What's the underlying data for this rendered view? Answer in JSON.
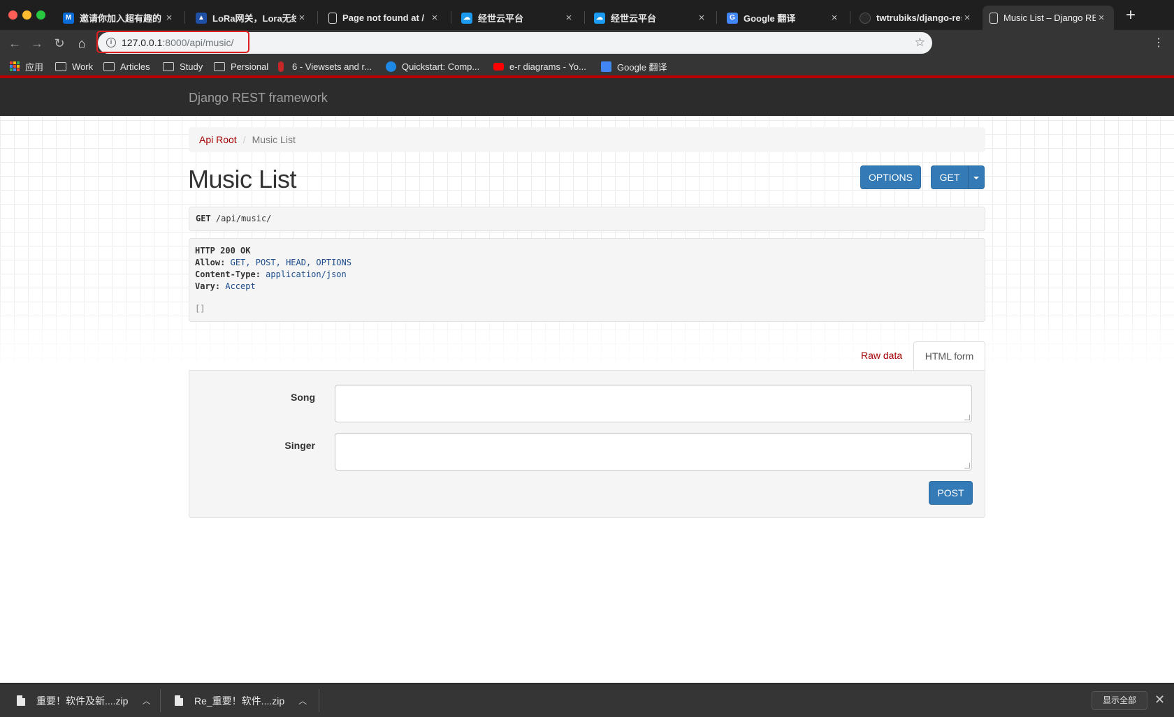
{
  "browser": {
    "tabs": [
      {
        "label": "邀请你加入超有趣的 CSDN",
        "icon": "mail-icon",
        "color": "#0a6cd6"
      },
      {
        "label": "LoRa网关，Lora无线数传",
        "icon": "lora-icon",
        "color": "#4285f4"
      },
      {
        "label": "Page not found at /",
        "icon": "page-icon",
        "color": "#cccccc"
      },
      {
        "label": "经世云平台",
        "icon": "cloud-icon",
        "color": "#1a9bf0"
      },
      {
        "label": "经世云平台",
        "icon": "cloud-icon",
        "color": "#1a9bf0"
      },
      {
        "label": "Google 翻译",
        "icon": "translate-icon",
        "color": "#4285f4"
      },
      {
        "label": "twtrubiks/django-rest-framework",
        "icon": "github-icon",
        "color": "#333333"
      },
      {
        "label": "Music List – Django REST framework",
        "icon": "page-icon",
        "color": "#cccccc",
        "active": true
      }
    ],
    "url_host": "127.0.0.1",
    "url_rest": ":8000/api/music/",
    "bookmarks": [
      {
        "label": "应用",
        "kind": "apps"
      },
      {
        "label": "Work",
        "kind": "folder"
      },
      {
        "label": "Articles",
        "kind": "folder"
      },
      {
        "label": "Study",
        "kind": "folder"
      },
      {
        "label": "Persional",
        "kind": "folder"
      },
      {
        "label": "6 - Viewsets and r...",
        "kind": "bookmark-icon",
        "color": "#c62828"
      },
      {
        "label": "Quickstart: Comp...",
        "kind": "edge-icon",
        "color": "#1e88e5"
      },
      {
        "label": "e-r diagrams - Yo...",
        "kind": "youtube-icon",
        "color": "#ff0000"
      },
      {
        "label": "Google 翻译",
        "kind": "translate-icon",
        "color": "#4285f4"
      }
    ]
  },
  "drf": {
    "brand": "Django REST framework",
    "breadcrumb": {
      "root": "Api Root",
      "sep": "/",
      "current": "Music List"
    },
    "title": "Music List",
    "options_label": "OPTIONS",
    "get_label": "GET",
    "request": {
      "method": "GET",
      "path": "/api/music/"
    },
    "response": {
      "status": "HTTP 200 OK",
      "allow_key": "Allow:",
      "allow_val": "GET, POST, HEAD, OPTIONS",
      "ctype_key": "Content-Type:",
      "ctype_val": "application/json",
      "vary_key": "Vary:",
      "vary_val": "Accept",
      "body": "[]"
    },
    "tab_raw": "Raw data",
    "tab_html": "HTML form",
    "form": {
      "song_label": "Song",
      "singer_label": "Singer",
      "song_value": "",
      "singer_value": "",
      "post_label": "POST"
    }
  },
  "downloads": {
    "items": [
      {
        "label": "重要！软件及新....zip"
      },
      {
        "label": "Re_重要！软件....zip"
      }
    ],
    "show_all": "显示全部"
  },
  "colors": {
    "accent_red": "#a30000",
    "button_blue": "#337ab7",
    "navbar": "#2c2c2c"
  }
}
